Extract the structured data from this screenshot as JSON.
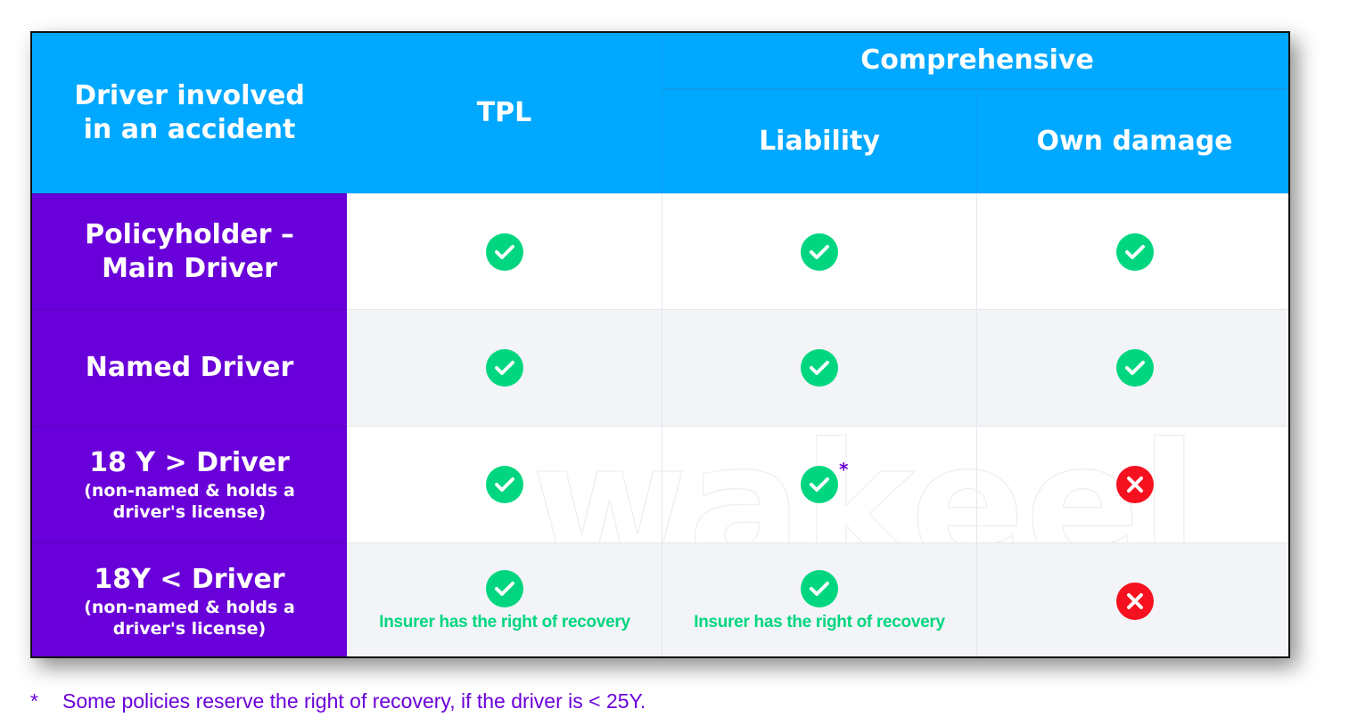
{
  "header": {
    "col0": "Driver involved in an accident",
    "tpl": "TPL",
    "comprehensive": "Comprehensive",
    "liability": "Liability",
    "own_damage": "Own damage"
  },
  "rows": [
    {
      "title": "Policyholder – Main Driver",
      "sub": "",
      "tpl": "check",
      "liability": "check",
      "own_damage": "check"
    },
    {
      "title": "Named Driver",
      "sub": "",
      "tpl": "check",
      "liability": "check",
      "own_damage": "check"
    },
    {
      "title": "18 Y > Driver",
      "sub": "(non-named & holds a driver's license)",
      "tpl": "check",
      "liability": "check*",
      "own_damage": "cross"
    },
    {
      "title": "18Y < Driver",
      "sub": "(non-named & holds a driver's license)",
      "tpl": "check",
      "liability": "check",
      "own_damage": "cross",
      "tpl_note": "Insurer has the right of recovery",
      "liability_note": "Insurer has the right of recovery"
    }
  ],
  "asterisk": "*",
  "footnote": {
    "mark": "*",
    "text": "Some policies reserve the right of recovery, if the driver is < 25Y."
  },
  "watermark": "wakeel",
  "colors": {
    "header": "#00a8ff",
    "left_column": "#6a00d9",
    "check": "#00d67f",
    "cross": "#f5111f"
  }
}
